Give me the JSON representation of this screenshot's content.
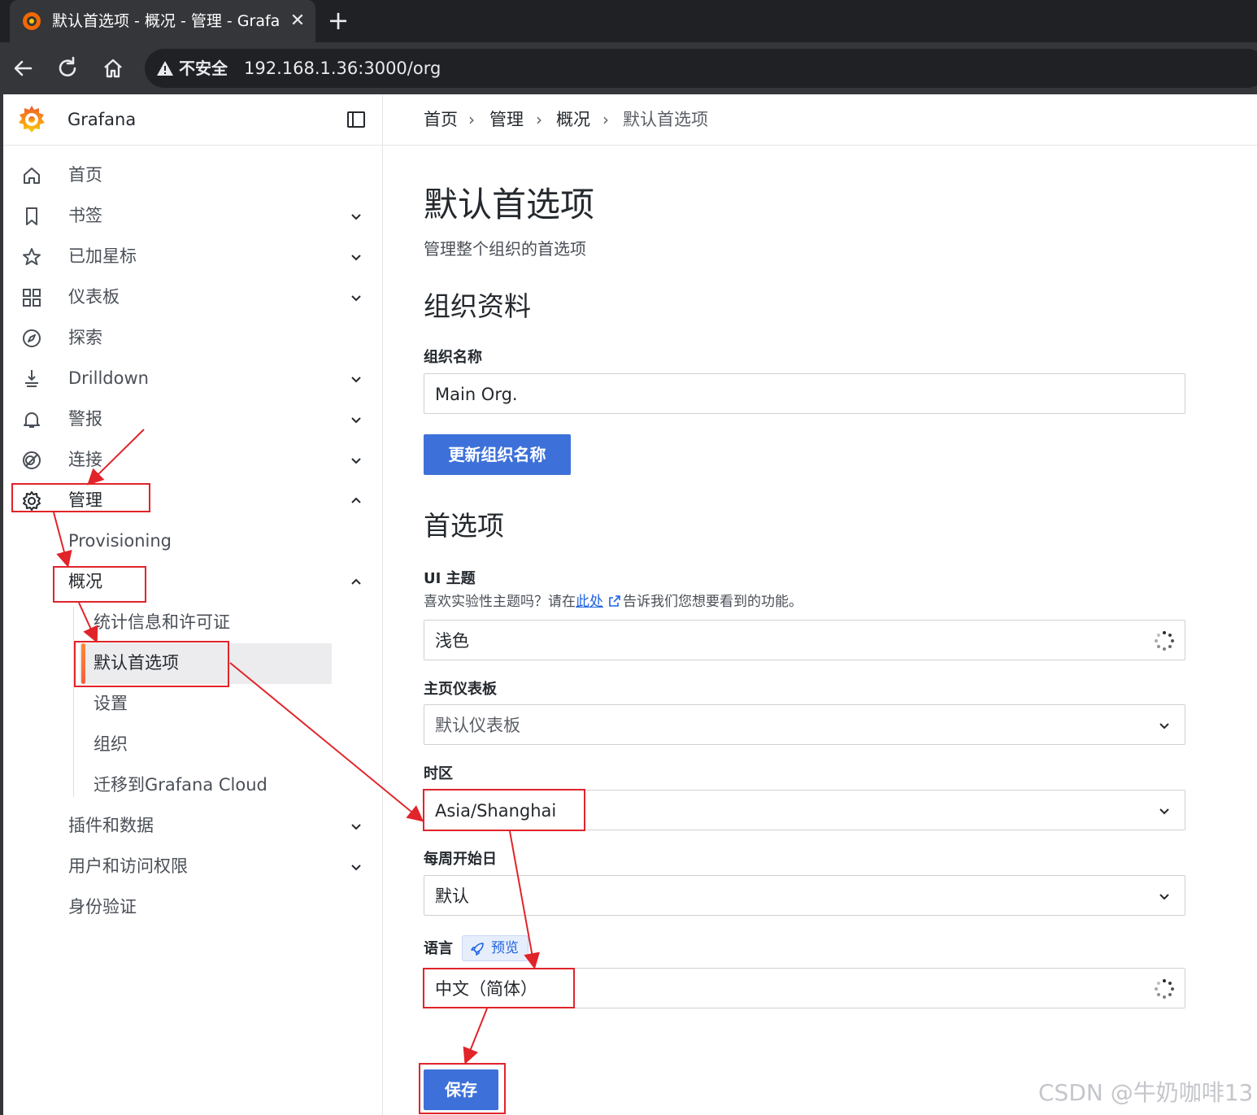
{
  "browser": {
    "tab_title": "默认首选项 - 概况 - 管理 - Grafana",
    "tab_close": "✕",
    "new_tab": "+",
    "security_label": "不安全",
    "url": "192.168.1.36:3000/org"
  },
  "sidebar": {
    "brand": "Grafana",
    "items": [
      {
        "label": "首页",
        "icon": "home-icon"
      },
      {
        "label": "书签",
        "icon": "bookmark-icon"
      },
      {
        "label": "已加星标",
        "icon": "star-icon"
      },
      {
        "label": "仪表板",
        "icon": "grid-icon"
      },
      {
        "label": "探索",
        "icon": "compass-icon"
      },
      {
        "label": "Drilldown",
        "icon": "drilldown-icon"
      },
      {
        "label": "警报",
        "icon": "bell-icon"
      },
      {
        "label": "连接",
        "icon": "link-icon"
      },
      {
        "label": "管理",
        "icon": "gear-icon"
      }
    ],
    "admin_children": {
      "provisioning": "Provisioning",
      "overview": "概况",
      "overview_children": [
        "统计信息和许可证",
        "默认首选项",
        "设置",
        "组织",
        "迁移到Grafana Cloud"
      ],
      "plugins": "插件和数据",
      "users": "用户和访问权限",
      "auth": "身份验证"
    }
  },
  "breadcrumb": {
    "items": [
      "首页",
      "管理",
      "概况",
      "默认首选项"
    ],
    "separator": "›"
  },
  "page": {
    "title": "默认首选项",
    "subtitle": "管理整个组织的首选项",
    "org_section": "组织资料",
    "org_name_label": "组织名称",
    "org_name_value": "Main Org.",
    "update_button": "更新组织名称",
    "prefs_section": "首选项",
    "ui_theme_label": "UI 主题",
    "ui_theme_desc_before": "喜欢实验性主题吗？请在",
    "ui_theme_desc_link": "此处",
    "ui_theme_desc_after": "告诉我们您想要看到的功能。",
    "ui_theme_value": "浅色",
    "home_dashboard_label": "主页仪表板",
    "home_dashboard_placeholder": "默认仪表板",
    "timezone_label": "时区",
    "timezone_value": "Asia/Shanghai",
    "week_start_label": "每周开始日",
    "week_start_value": "默认",
    "language_label": "语言",
    "language_badge": "预览",
    "language_value": "中文（简体）",
    "save_button": "保存"
  },
  "watermark": "CSDN @牛奶咖啡13",
  "colors": {
    "primary": "#3d71d9",
    "annotation": "#e0242a",
    "active_bar": "#f55f3e"
  }
}
